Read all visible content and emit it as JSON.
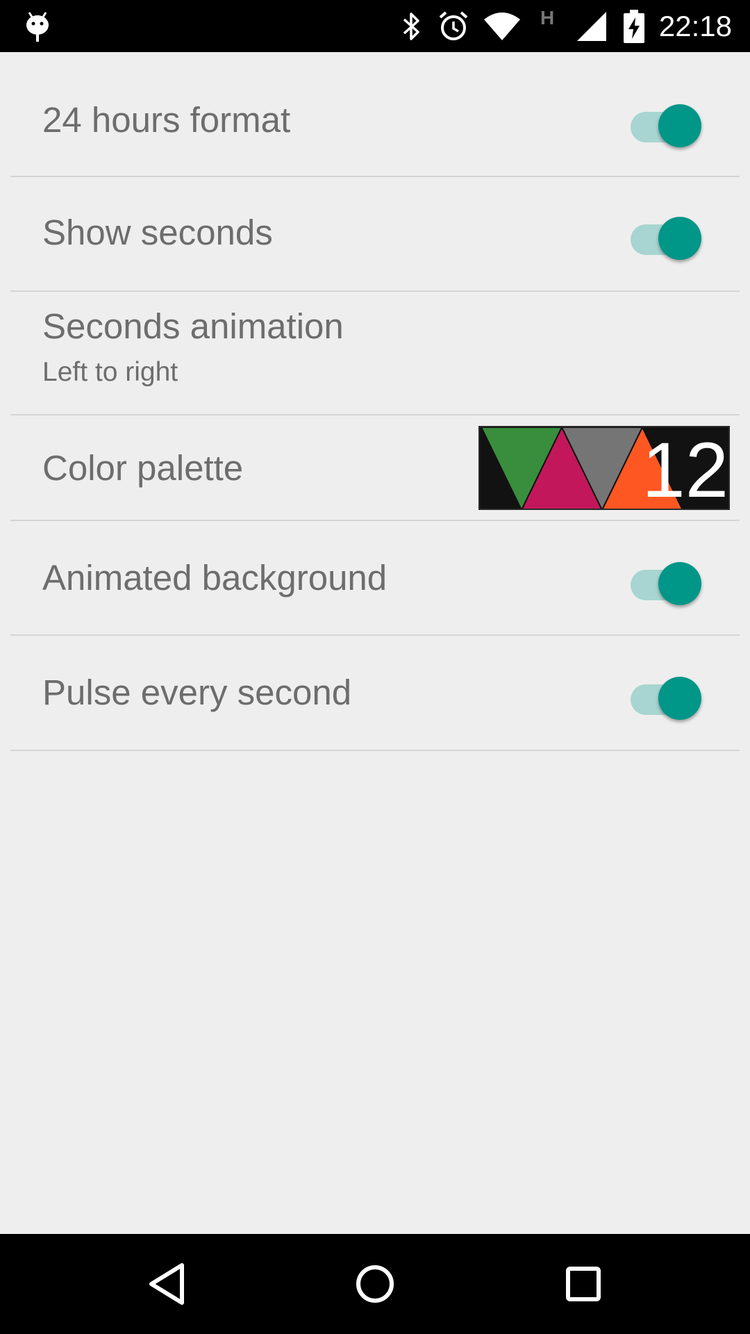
{
  "status_bar": {
    "time": "22:18",
    "network_type": "H",
    "icons": [
      "android-notification-icon",
      "bluetooth-icon",
      "alarm-icon",
      "wifi-icon",
      "cell-signal-icon",
      "battery-charging-icon"
    ]
  },
  "preferences": [
    {
      "title": "24 hours format",
      "type": "switch",
      "checked": true
    },
    {
      "title": "Show seconds",
      "type": "switch",
      "checked": true
    },
    {
      "title": "Seconds animation",
      "summary": "Left to right",
      "type": "list"
    },
    {
      "title": "Color palette",
      "type": "palette",
      "palette_number": "12",
      "palette_colors": [
        "#388e3c",
        "#c2185b",
        "#757575",
        "#ff5722"
      ]
    },
    {
      "title": "Animated background",
      "type": "switch",
      "checked": true
    },
    {
      "title": "Pulse every second",
      "type": "switch",
      "checked": true
    }
  ],
  "colors": {
    "accent": "#009688",
    "switch_track_on": "#a8d5d1",
    "background": "#eeeeee",
    "text": "#6d6d6d"
  },
  "nav_bar": {
    "icons": [
      "back-icon",
      "home-icon",
      "recents-icon"
    ]
  }
}
